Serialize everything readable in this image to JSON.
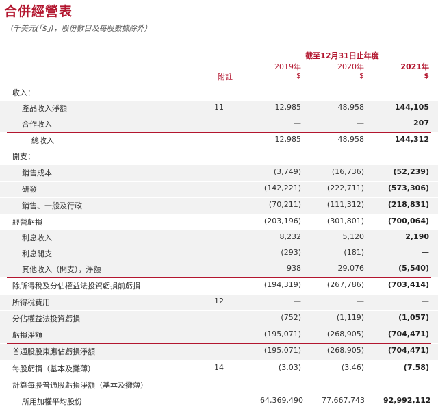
{
  "title": "合併經營表",
  "subtitle": "（千美元(「$」)，股份數目及每股數據除外）",
  "header": {
    "period": "截至12月31日止年度",
    "years": [
      "2019年",
      "2020年",
      "2021年"
    ],
    "currency": [
      "$",
      "$",
      "$"
    ],
    "note_label": "附註"
  },
  "rows": [
    {
      "label": "收入：",
      "indent": 0,
      "note": "",
      "v2019": "",
      "v2020": "",
      "v2021": ""
    },
    {
      "label": "產品收入淨額",
      "indent": 1,
      "note": "11",
      "v2019": "12,985",
      "v2020": "48,958",
      "v2021": "144,105"
    },
    {
      "label": "合作收入",
      "indent": 1,
      "note": "",
      "v2019": "—",
      "v2020": "—",
      "v2021": "207"
    },
    {
      "label": "總收入",
      "indent": 2,
      "note": "",
      "v2019": "12,985",
      "v2020": "48,958",
      "v2021": "144,312"
    },
    {
      "label": "開支：",
      "indent": 0,
      "note": "",
      "v2019": "",
      "v2020": "",
      "v2021": ""
    },
    {
      "label": "銷售成本",
      "indent": 1,
      "note": "",
      "v2019": "(3,749)",
      "v2020": "(16,736)",
      "v2021": "(52,239)"
    },
    {
      "label": "研發",
      "indent": 1,
      "note": "",
      "v2019": "(142,221)",
      "v2020": "(222,711)",
      "v2021": "(573,306)"
    },
    {
      "label": "銷售、一般及行政",
      "indent": 1,
      "note": "",
      "v2019": "(70,211)",
      "v2020": "(111,312)",
      "v2021": "(218,831)"
    },
    {
      "label": "經營虧損",
      "indent": 0,
      "note": "",
      "v2019": "(203,196)",
      "v2020": "(301,801)",
      "v2021": "(700,064)"
    },
    {
      "label": "利息收入",
      "indent": 1,
      "note": "",
      "v2019": "8,232",
      "v2020": "5,120",
      "v2021": "2,190"
    },
    {
      "label": "利息開支",
      "indent": 1,
      "note": "",
      "v2019": "(293)",
      "v2020": "(181)",
      "v2021": "—"
    },
    {
      "label": "其他收入（開支），淨額",
      "indent": 1,
      "note": "",
      "v2019": "938",
      "v2020": "29,076",
      "v2021": "(5,540)"
    },
    {
      "label": "除所得稅及分佔權益法投資虧損前虧損",
      "indent": 0,
      "note": "",
      "v2019": "(194,319)",
      "v2020": "(267,786)",
      "v2021": "(703,414)"
    },
    {
      "label": "所得稅費用",
      "indent": 0,
      "note": "12",
      "v2019": "—",
      "v2020": "—",
      "v2021": "—"
    },
    {
      "label": "分佔權益法投資虧損",
      "indent": 0,
      "note": "",
      "v2019": "(752)",
      "v2020": "(1,119)",
      "v2021": "(1,057)"
    },
    {
      "label": "虧損淨額",
      "indent": 0,
      "note": "",
      "v2019": "(195,071)",
      "v2020": "(268,905)",
      "v2021": "(704,471)"
    },
    {
      "label": "普通股股東應佔虧損淨額",
      "indent": 0,
      "note": "",
      "v2019": "(195,071)",
      "v2020": "(268,905)",
      "v2021": "(704,471)"
    },
    {
      "label": "每股虧損（基本及攤薄）",
      "indent": 0,
      "note": "14",
      "v2019": "(3.03)",
      "v2020": "(3.46)",
      "v2021": "(7.58)"
    },
    {
      "label": "計算每股普通股虧損淨額（基本及攤薄）",
      "indent": 0,
      "note": "",
      "v2019": "",
      "v2020": "",
      "v2021": ""
    },
    {
      "label": "所用加權平均股份",
      "indent": 1,
      "note": "",
      "v2019": "64,369,490",
      "v2020": "77,667,743",
      "v2021": "92,992,112"
    }
  ],
  "colors": {
    "accent": "#b3162f",
    "shade": "#f2f2f2"
  }
}
